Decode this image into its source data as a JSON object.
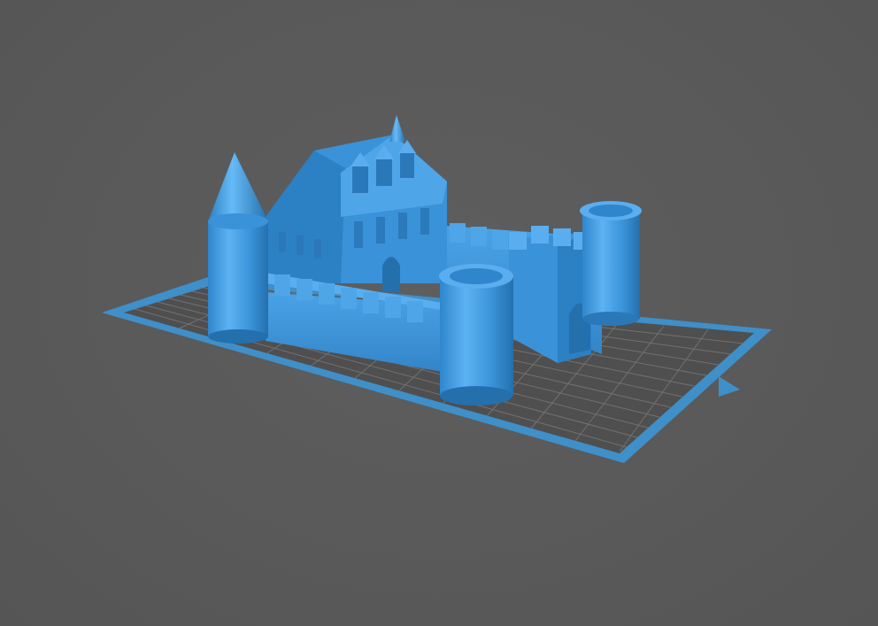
{
  "viewport": {
    "kind": "3d-print-preview"
  },
  "scene": {
    "object": "castle-model",
    "bed": "print-bed-grid"
  },
  "colors": {
    "background": "#5a5a5a",
    "bed_frame": "#3f8fc9",
    "bed_surface": "#4d4d4d",
    "grid_line": "#7a7a7a",
    "model_light": "#5aaef0",
    "model_mid": "#3d95da",
    "model_dark": "#2a78b8",
    "model_shadow": "#1f5f96"
  }
}
